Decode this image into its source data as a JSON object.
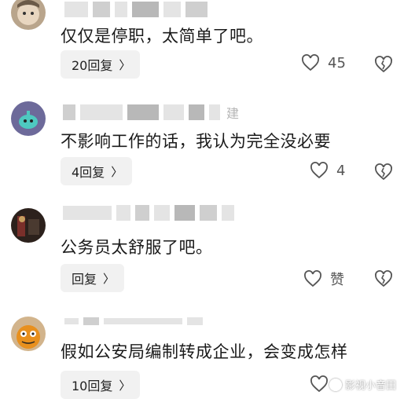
{
  "comments": [
    {
      "name_suffix": "",
      "text": "仅仅是停职，太简单了吧。",
      "reply_label": "20回复",
      "like_count": "45"
    },
    {
      "name_suffix": "建",
      "text": "不影响工作的话，我认为完全没必要",
      "reply_label": "4回复",
      "like_count": "4"
    },
    {
      "name_suffix": "",
      "text": "公务员太舒服了吧。",
      "reply_label": "回复",
      "like_count": "赞"
    },
    {
      "name_suffix": "",
      "text": "假如公安局编制转成企业，会变成怎样",
      "reply_label": "10回复",
      "like_count": ""
    }
  ],
  "watermark": {
    "text": "影视小音田"
  },
  "icons": {
    "chevron": "chevron-right-icon",
    "like": "heart-outline-icon",
    "dislike": "broken-heart-icon"
  },
  "colors": {
    "reply_bg": "#f1f1f1",
    "text": "#1b1b1b",
    "icon": "#555555"
  }
}
